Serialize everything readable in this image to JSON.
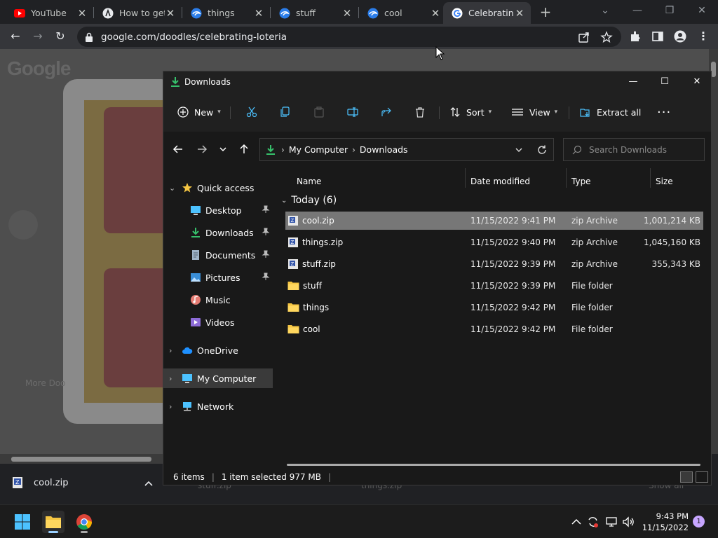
{
  "browser": {
    "tabs": [
      {
        "title": "YouTube",
        "icon": "youtube-icon"
      },
      {
        "title": "How to get",
        "icon": "site-icon"
      },
      {
        "title": "things",
        "icon": "edge-like-icon"
      },
      {
        "title": "stuff",
        "icon": "edge-like-icon"
      },
      {
        "title": "cool",
        "icon": "edge-like-icon"
      },
      {
        "title": "Celebrating",
        "icon": "google-icon"
      }
    ],
    "active_tab": 5,
    "url": "google.com/doodles/celebrating-loteria",
    "page": {
      "logo": "Google",
      "more": "More Doo"
    }
  },
  "download_shelf": {
    "item": "cool.zip",
    "ghost_items": [
      "stuff.zip",
      "things.zip",
      "Show all"
    ]
  },
  "explorer": {
    "title": "Downloads",
    "commands": {
      "new": "New",
      "sort": "Sort",
      "view": "View",
      "extract": "Extract all"
    },
    "breadcrumb": [
      "My Computer",
      "Downloads"
    ],
    "search_placeholder": "Search Downloads",
    "nav": {
      "quick_access": "Quick access",
      "desktop": "Desktop",
      "downloads": "Downloads",
      "documents": "Documents",
      "pictures": "Pictures",
      "music": "Music",
      "videos": "Videos",
      "onedrive": "OneDrive",
      "my_computer": "My Computer",
      "network": "Network"
    },
    "columns": {
      "name": "Name",
      "date": "Date modified",
      "type": "Type",
      "size": "Size"
    },
    "group": "Today (6)",
    "files": [
      {
        "name": "cool.zip",
        "date": "11/15/2022 9:41 PM",
        "type": "zip Archive",
        "size": "1,001,214 KB",
        "kind": "zip",
        "selected": true
      },
      {
        "name": "things.zip",
        "date": "11/15/2022 9:40 PM",
        "type": "zip Archive",
        "size": "1,045,160 KB",
        "kind": "zip",
        "selected": false
      },
      {
        "name": "stuff.zip",
        "date": "11/15/2022 9:39 PM",
        "type": "zip Archive",
        "size": "355,343 KB",
        "kind": "zip",
        "selected": false
      },
      {
        "name": "stuff",
        "date": "11/15/2022 9:39 PM",
        "type": "File folder",
        "size": "",
        "kind": "folder",
        "selected": false
      },
      {
        "name": "things",
        "date": "11/15/2022 9:42 PM",
        "type": "File folder",
        "size": "",
        "kind": "folder",
        "selected": false
      },
      {
        "name": "cool",
        "date": "11/15/2022 9:42 PM",
        "type": "File folder",
        "size": "",
        "kind": "folder",
        "selected": false
      }
    ],
    "status": {
      "count": "6 items",
      "selection": "1 item selected 977 MB"
    }
  },
  "taskbar": {
    "time": "9:43 PM",
    "date": "11/15/2022",
    "notification_count": "1"
  },
  "colors": {
    "explorer_bg": "#191919",
    "selection": "#777777",
    "accent_blue": "#4cc2ff",
    "folder_yellow": "#f4c542",
    "download_green": "#36c06b"
  }
}
